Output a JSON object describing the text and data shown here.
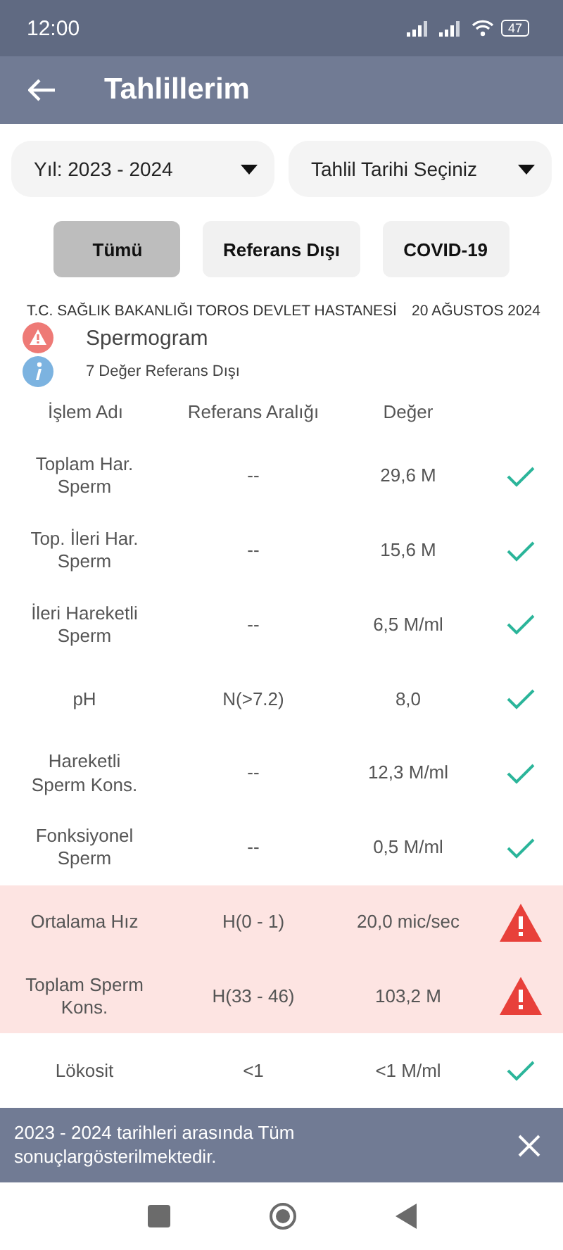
{
  "status_bar": {
    "time": "12:00",
    "battery": "47"
  },
  "app_bar": {
    "title": "Tahlillerim"
  },
  "filters": [
    {
      "label": "Yıl: 2023 - 2024"
    },
    {
      "label": "Tahlil Tarihi Seçiniz"
    }
  ],
  "chips": [
    {
      "label": "Tümü",
      "selected": true
    },
    {
      "label": "Referans Dışı",
      "selected": false
    },
    {
      "label": "COVID-19",
      "selected": false
    }
  ],
  "report": {
    "hospital": "T.C. SAĞLIK BAKANLIĞI TOROS DEVLET HASTANESİ",
    "date": "20 AĞUSTOS 2024",
    "test": "Spermogram",
    "summary": "7 Değer Referans Dışı"
  },
  "table": {
    "columns": [
      "İşlem Adı",
      "Referans Aralığı",
      "Değer"
    ],
    "rows": [
      {
        "name": "Toplam Har. Sperm",
        "range": "--",
        "value": "29,6 M",
        "out_of_range": false
      },
      {
        "name": "Top. İleri Har. Sperm",
        "range": "--",
        "value": "15,6 M",
        "out_of_range": false
      },
      {
        "name": "İleri Hareketli Sperm",
        "range": "--",
        "value": "6,5 M/ml",
        "out_of_range": false
      },
      {
        "name": "pH",
        "range": "N(>7.2)",
        "value": "8,0",
        "out_of_range": false
      },
      {
        "name": "Hareketli Sperm Kons.",
        "range": "--",
        "value": "12,3 M/ml",
        "out_of_range": false
      },
      {
        "name": "Fonksiyonel Sperm",
        "range": "--",
        "value": "0,5 M/ml",
        "out_of_range": false
      },
      {
        "name": "Ortalama Hız",
        "range": "H(0 - 1)",
        "value": "20,0 mic/sec",
        "out_of_range": true
      },
      {
        "name": "Toplam Sperm Kons.",
        "range": "H(33 - 46)",
        "value": "103,2 M",
        "out_of_range": true
      },
      {
        "name": "Lökosit",
        "range": "<1",
        "value": "<1 M/ml",
        "out_of_range": false
      }
    ]
  },
  "banner": {
    "message": "2023 - 2024 tarihleri arasında Tüm sonuçlargösterilmektedir."
  }
}
